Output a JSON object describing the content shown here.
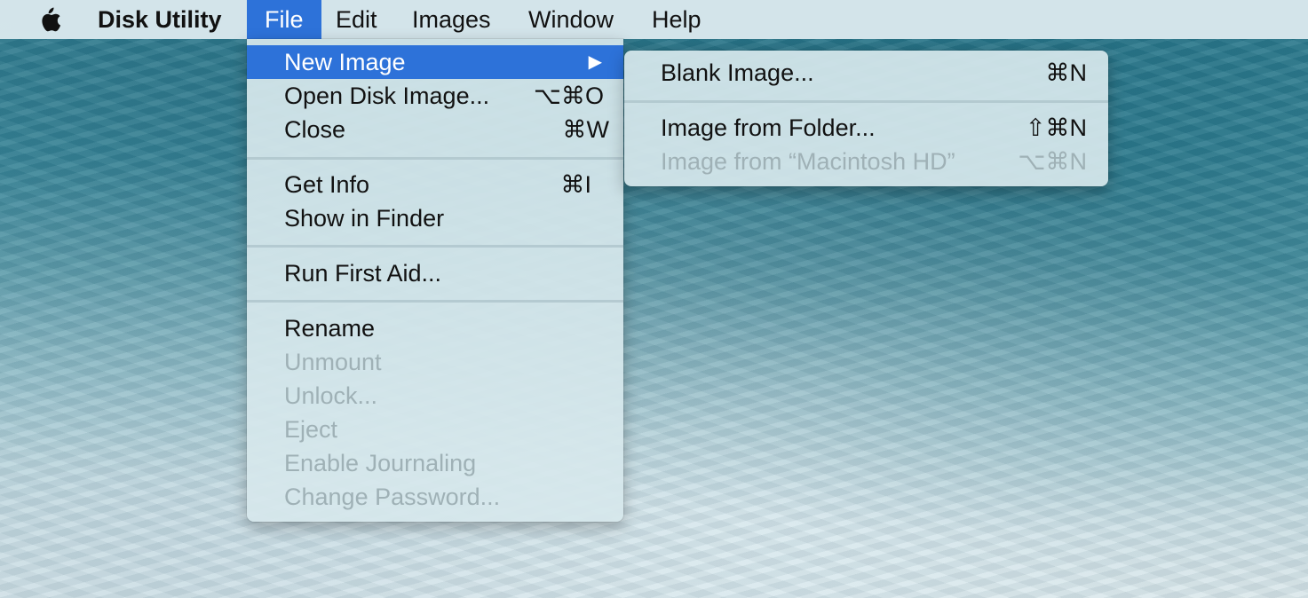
{
  "menubar": {
    "apple_icon": "apple-logo-icon",
    "app_name": "Disk Utility",
    "menus": [
      "File",
      "Edit",
      "Images",
      "Window",
      "Help"
    ],
    "active_menu": "File"
  },
  "file_menu": {
    "items": [
      {
        "label": "New Image",
        "shortcut": "",
        "submenu_arrow": "▶",
        "state": "highlighted"
      },
      {
        "label": "Open Disk Image...",
        "shortcut": "⌥⌘O",
        "state": "enabled"
      },
      {
        "label": "Close",
        "shortcut": "⌘W",
        "state": "enabled"
      },
      {
        "label": "Get Info",
        "shortcut": "⌘I",
        "state": "enabled"
      },
      {
        "label": "Show in Finder",
        "shortcut": "",
        "state": "enabled"
      },
      {
        "label": "Run First Aid...",
        "shortcut": "",
        "state": "enabled"
      },
      {
        "label": "Rename",
        "shortcut": "",
        "state": "enabled"
      },
      {
        "label": "Unmount",
        "shortcut": "",
        "state": "disabled"
      },
      {
        "label": "Unlock...",
        "shortcut": "",
        "state": "disabled"
      },
      {
        "label": "Eject",
        "shortcut": "",
        "state": "disabled"
      },
      {
        "label": "Enable Journaling",
        "shortcut": "",
        "state": "disabled"
      },
      {
        "label": "Change Password...",
        "shortcut": "",
        "state": "disabled"
      }
    ]
  },
  "new_image_submenu": {
    "items": [
      {
        "label": "Blank Image...",
        "shortcut": "⌘N",
        "state": "enabled"
      },
      {
        "label": "Image from Folder...",
        "shortcut": "⇧⌘N",
        "state": "enabled"
      },
      {
        "label": "Image from “Macintosh HD”",
        "shortcut": "⌥⌘N",
        "state": "disabled"
      }
    ]
  },
  "colors": {
    "highlight": "#2d72d9",
    "disabled_text": "#9fb1b6"
  }
}
